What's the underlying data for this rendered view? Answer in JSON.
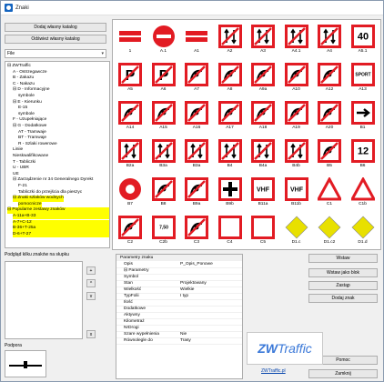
{
  "window": {
    "title": "Znaki"
  },
  "left_buttons": {
    "add_own_catalog": "Dodaj własny katalog",
    "refresh_own_catalog": "Odśwież własny katalog"
  },
  "combo": {
    "value": "File"
  },
  "tree": [
    {
      "text": "⊟ ZWTraffic",
      "indent": 0
    },
    {
      "text": "A - Ostrzegawcze",
      "indent": 1
    },
    {
      "text": "B - Zakazu",
      "indent": 1
    },
    {
      "text": "C - Nakazu",
      "indent": 1
    },
    {
      "text": "⊟ D - Informacyjne",
      "indent": 1
    },
    {
      "text": "symbole",
      "indent": 2
    },
    {
      "text": "⊟ E - Kierunku",
      "indent": 1
    },
    {
      "text": "E-15",
      "indent": 2
    },
    {
      "text": "symbole",
      "indent": 2
    },
    {
      "text": "F - Uzupełniające",
      "indent": 1
    },
    {
      "text": "⊟ G - Dodatkowe",
      "indent": 1
    },
    {
      "text": "AT - Tramwaje",
      "indent": 2
    },
    {
      "text": "BT - Tramwaje",
      "indent": 2
    },
    {
      "text": "R - Szlaki rowerowe",
      "indent": 2
    },
    {
      "text": "Liniie",
      "indent": 1
    },
    {
      "text": "Nieskwalifikowane",
      "indent": 1
    },
    {
      "text": "T - Tabliczki",
      "indent": 1
    },
    {
      "text": "U - UBR",
      "indent": 1
    },
    {
      "text": "UE",
      "indent": 1
    },
    {
      "text": "⊟ Zarządzenie nr 34 Generalnego Dyrekt",
      "indent": 1
    },
    {
      "text": "F-21",
      "indent": 2
    },
    {
      "text": "Tabliczki do przejścia dla pieszyc",
      "indent": 2
    },
    {
      "text": "⊟ Znaki szlaków wodnych",
      "indent": 1,
      "hl": true
    },
    {
      "text": "pomocnicze",
      "indent": 2,
      "hl": true
    },
    {
      "text": "⊟ Popularne zestawy znaków",
      "indent": 0,
      "block": true
    },
    {
      "text": "A-11a+B-33",
      "indent": 1,
      "block": true
    },
    {
      "text": "A-7+C-12",
      "indent": 1,
      "block": true
    },
    {
      "text": "B-36+T-25a",
      "indent": 1,
      "block": true
    },
    {
      "text": "D-6+T-27",
      "indent": 1,
      "block": true
    }
  ],
  "signs": [
    {
      "label": "1",
      "kind": "bar2"
    },
    {
      "label": "A.1",
      "kind": "noentry"
    },
    {
      "label": "A1",
      "kind": "bar2"
    },
    {
      "label": "A2",
      "kind": "sq-arrows"
    },
    {
      "label": "A3",
      "kind": "sq-arrows"
    },
    {
      "label": "A4.1",
      "kind": "sq-arrows"
    },
    {
      "label": "A4",
      "kind": "sq-arrows"
    },
    {
      "label": "A5.1",
      "kind": "sq-text",
      "text": "40"
    },
    {
      "label": "A5",
      "kind": "sq-p"
    },
    {
      "label": "A6",
      "kind": "sq-p"
    },
    {
      "label": "A7",
      "kind": "sq-fig"
    },
    {
      "label": "A8",
      "kind": "sq-fig"
    },
    {
      "label": "A9a",
      "kind": "sq-fig"
    },
    {
      "label": "A10",
      "kind": "sq-fig"
    },
    {
      "label": "A12",
      "kind": "sq-fig"
    },
    {
      "label": "A13",
      "kind": "sq-text",
      "text": "SPORT"
    },
    {
      "label": "A14",
      "kind": "sq-fig"
    },
    {
      "label": "A15",
      "kind": "sq-fig"
    },
    {
      "label": "A16",
      "kind": "sq-fig"
    },
    {
      "label": "A17",
      "kind": "sq-fig"
    },
    {
      "label": "A18",
      "kind": "sq-fig"
    },
    {
      "label": "A19",
      "kind": "sq-fig"
    },
    {
      "label": "A20",
      "kind": "sq-fig"
    },
    {
      "label": "B1",
      "kind": "sq-right"
    },
    {
      "label": "B2a",
      "kind": "sq-arrows"
    },
    {
      "label": "B3a",
      "kind": "sq-arrows"
    },
    {
      "label": "B3a",
      "kind": "sq-arrows"
    },
    {
      "label": "B4",
      "kind": "sq-arrows"
    },
    {
      "label": "B4a",
      "kind": "sq-arrows"
    },
    {
      "label": "B4b",
      "kind": "sq-arrows"
    },
    {
      "label": "B5",
      "kind": "sq-fig"
    },
    {
      "label": "B6",
      "kind": "sq-text",
      "text": "12"
    },
    {
      "label": "B7",
      "kind": "circle-fill"
    },
    {
      "label": "B8",
      "kind": "sq-fig"
    },
    {
      "label": "B9a",
      "kind": "sq-fig"
    },
    {
      "label": "B9b",
      "kind": "sq-cross"
    },
    {
      "label": "B11a",
      "kind": "sq-text",
      "text": "VHF"
    },
    {
      "label": "B11b",
      "kind": "sq-text",
      "text": "VHF"
    },
    {
      "label": "C1",
      "kind": "tri"
    },
    {
      "label": "C1b",
      "kind": "tri"
    },
    {
      "label": "C2",
      "kind": "sq-fig"
    },
    {
      "label": "C2b",
      "kind": "sq-text",
      "text": "7,50"
    },
    {
      "label": "C3",
      "kind": "sq-fig"
    },
    {
      "label": "C4",
      "kind": "sq-plain"
    },
    {
      "label": "C5",
      "kind": "sq-plain"
    },
    {
      "label": "D1.c",
      "kind": "diamond"
    },
    {
      "label": "D1.c2",
      "kind": "diamond"
    },
    {
      "label": "D1.d",
      "kind": "diamond"
    }
  ],
  "bottom_left": {
    "title": "Podgląd kilku znaków na słupku",
    "add": "+",
    "up": "^",
    "down": "v",
    "remove": "x",
    "podpora_label": "Podpora"
  },
  "props": {
    "head": "Parametry znaku",
    "rows": [
      {
        "k": "Opis",
        "v": "P_Opis_Ponowe"
      },
      {
        "k": "⊟ Parametry",
        "v": ""
      },
      {
        "k": "Symbol",
        "v": ""
      },
      {
        "k": "Stan",
        "v": "Projektowany"
      },
      {
        "k": "Wielkość",
        "v": "Wielkie"
      },
      {
        "k": "TypFolii",
        "v": "I typ"
      },
      {
        "k": "Ilość",
        "v": ""
      },
      {
        "k": "Dodatkowe",
        "v": ""
      },
      {
        "k": "Aktywny",
        "v": ""
      },
      {
        "k": "Kilometraż",
        "v": ""
      },
      {
        "k": "NrDrogi",
        "v": ""
      },
      {
        "k": "Szare wypełnienia",
        "v": "Nie"
      },
      {
        "k": "Równolegle do",
        "v": "Trasy"
      }
    ]
  },
  "right_buttons": {
    "insert": "Wstaw",
    "insert_block": "Wstaw jako blok",
    "replace": "Zastąp",
    "add_sign": "Dodaj znak",
    "help": "Pomoc",
    "close": "Zamknij"
  },
  "logo": {
    "zw": "ZW",
    "traffic": "Traffic",
    "link": "ZWTraffic.pl"
  },
  "colors": {
    "red": "#e21b23",
    "yellow": "#ffff00",
    "diamond": "#e8e000"
  }
}
